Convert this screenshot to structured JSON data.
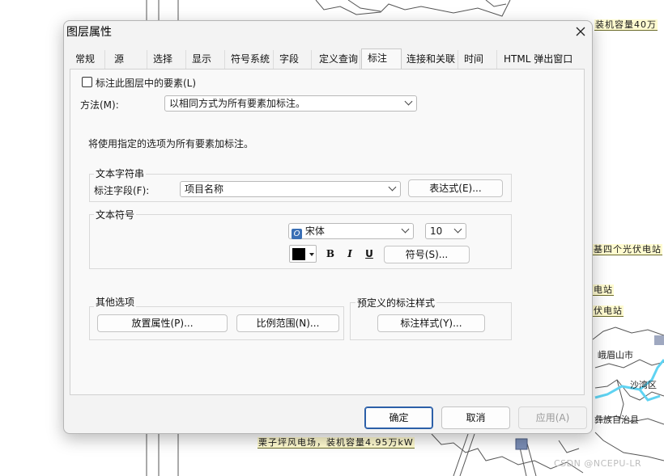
{
  "map": {
    "labels": {
      "top_right": "装机容量40万",
      "station_a": "基四个光伏电站",
      "station_b": "电站",
      "station_c": "伏电站",
      "city_emei": "峨眉山市",
      "district_shawan": "沙湾区",
      "county_ebian": "彝族自治县",
      "wind_farm": "栗子坪风电场，装机容量4.95万kW",
      "watermark": "CSDN @NCEPU-LR"
    },
    "colors": {
      "label_bg": "#fffbd0",
      "river": "#5fd3f2",
      "boundary": "#555555"
    }
  },
  "dialog": {
    "title": "图层属性",
    "close_icon": "close-icon",
    "tabs": [
      {
        "label": "常规"
      },
      {
        "label": "源"
      },
      {
        "label": "选择"
      },
      {
        "label": "显示"
      },
      {
        "label": "符号系统"
      },
      {
        "label": "字段"
      },
      {
        "label": "定义查询"
      },
      {
        "label": "标注",
        "active": true
      },
      {
        "label": "连接和关联"
      },
      {
        "label": "时间"
      },
      {
        "label": "HTML 弹出窗口"
      }
    ],
    "label_features_checkbox": {
      "label": "标注此图层中的要素(L)",
      "checked": false
    },
    "method": {
      "label": "方法(M):",
      "value": "以相同方式为所有要素加标注。"
    },
    "info_text": "将使用指定的选项为所有要素加标注。",
    "text_string": {
      "legend": "文本字符串",
      "field_label": "标注字段(F):",
      "field_value": "项目名称",
      "expression_button": "表达式(E)..."
    },
    "text_symbol": {
      "legend": "文本符号",
      "font_icon": "opentype-font-icon",
      "font_name": "宋体",
      "font_size": "10",
      "color": "#000000",
      "bold": "B",
      "italic": "I",
      "underline": "U",
      "symbol_button": "符号(S)..."
    },
    "other_options": {
      "legend": "其他选项",
      "placement_button": "放置属性(P)...",
      "scale_button": "比例范围(N)..."
    },
    "predefined": {
      "legend": "预定义的标注样式",
      "style_button": "标注样式(Y)..."
    },
    "footer": {
      "ok": "确定",
      "cancel": "取消",
      "apply": "应用(A)"
    },
    "colors": {
      "ok_border": "#2b5fa8",
      "disabled_text": "#9a9a9a"
    }
  }
}
